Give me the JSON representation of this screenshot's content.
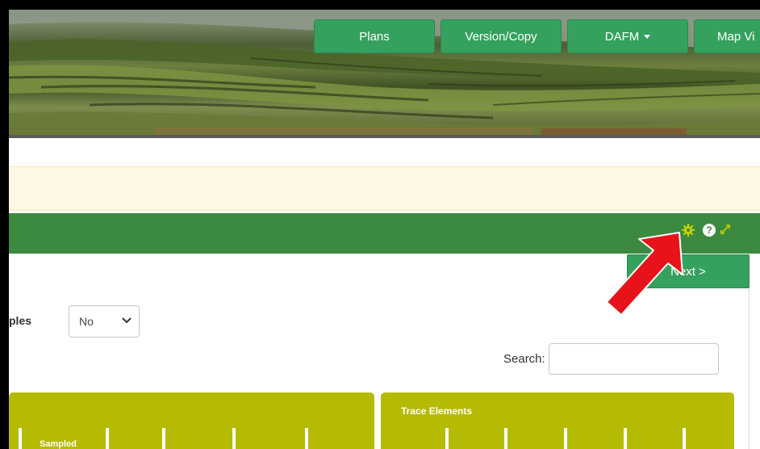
{
  "nav": {
    "plans": "Plans",
    "version_copy": "Version/Copy",
    "dafm": "DAFM",
    "map_view": "Map Vi"
  },
  "panel": {
    "icons": {
      "settings": "gear-icon",
      "help": "question-circle-icon",
      "expand": "expand-icon"
    },
    "help_glyph": "?",
    "next_label": "Next >"
  },
  "filters": {
    "samples_label": "ples",
    "samples_value": "No",
    "search_label": "Search:",
    "search_value": ""
  },
  "table": {
    "left_group": "",
    "right_group": "Trace Elements",
    "sampled_header": "Sampled"
  },
  "colors": {
    "nav_green": "#35a15f",
    "panel_green": "#3c8a3f",
    "olive": "#b5bb02",
    "notice": "#fcf8e3",
    "gear": "#c8d400",
    "arrow": "#e8121b"
  }
}
